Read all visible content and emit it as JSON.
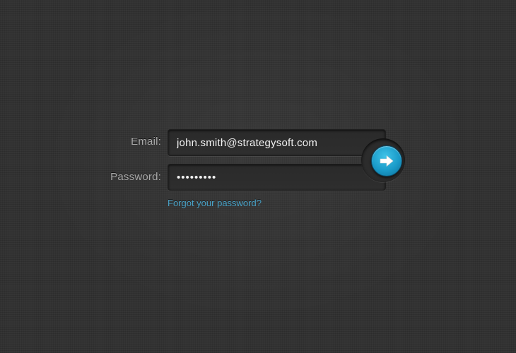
{
  "login": {
    "email_label": "Email:",
    "email_value": "john.smith@strategysoft.com",
    "password_label": "Password:",
    "password_value": "•••••••••",
    "submit_icon": "arrow-right-icon",
    "forgot_link": "Forgot your password?"
  },
  "colors": {
    "background": "#353535",
    "accent": "#1a9bc9",
    "link": "#4aa3c8",
    "label": "#a9a9a9",
    "input_text": "#f2f2f2"
  }
}
